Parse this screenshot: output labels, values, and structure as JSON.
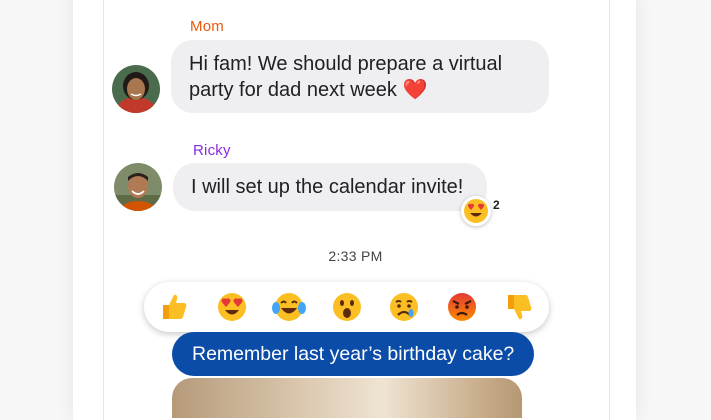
{
  "messages": [
    {
      "sender": "Mom",
      "sender_color": "#e8590c",
      "text": "Hi fam! We should prepare a virtual\nparty for dad next week ❤️"
    },
    {
      "sender": "Ricky",
      "sender_color": "#8a2be2",
      "text": "I will set up the calendar invite!",
      "reaction": {
        "emoji": "heart-eyes",
        "count": "2"
      }
    }
  ],
  "timestamp": "2:33 PM",
  "reaction_options": [
    "thumbs-up",
    "heart-eyes",
    "tears-of-joy",
    "surprised",
    "sad",
    "angry",
    "thumbs-down"
  ],
  "outgoing": {
    "text": "Remember last year’s birthday cake?",
    "color": "#0b4ca8"
  },
  "colors": {
    "bubble_gray": "#efeff1",
    "emoji_yellow": "#fbbf24"
  }
}
